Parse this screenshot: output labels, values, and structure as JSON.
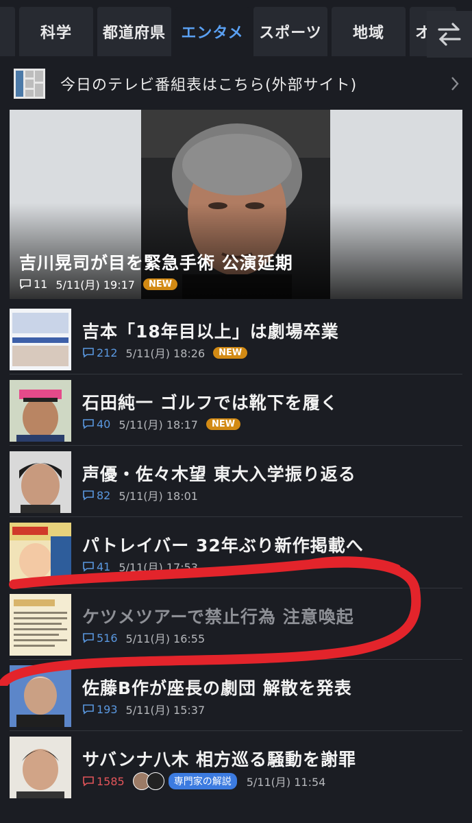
{
  "tabs": [
    {
      "label": "",
      "active": false
    },
    {
      "label": "科学",
      "active": false
    },
    {
      "label": "都道府県",
      "active": false
    },
    {
      "label": "エンタメ",
      "active": true
    },
    {
      "label": "スポーツ",
      "active": false
    },
    {
      "label": "地域",
      "active": false
    },
    {
      "label": "オ",
      "active": false
    }
  ],
  "tv_banner": {
    "text": "今日のテレビ番組表はこちら(外部サイト)"
  },
  "hero": {
    "title": "吉川晃司が目を緊急手術 公演延期",
    "comments": "11",
    "time": "5/11(月) 19:17",
    "badge": "NEW"
  },
  "articles": [
    {
      "title": "吉本「18年目以上」は劇場卒業",
      "comments": "212",
      "time": "5/11(月) 18:26",
      "badge": "NEW"
    },
    {
      "title": "石田純一 ゴルフでは靴下を履く",
      "comments": "40",
      "time": "5/11(月) 18:17",
      "badge": "NEW"
    },
    {
      "title": "声優・佐々木望 東大入学振り返る",
      "comments": "82",
      "time": "5/11(月) 18:01"
    },
    {
      "title": "パトレイバー 32年ぶり新作掲載へ",
      "comments": "41",
      "time": "5/11(月) 17:53"
    },
    {
      "title": "ケツメツアーで禁止行為 注意喚起",
      "comments": "516",
      "time": "5/11(月) 16:55"
    },
    {
      "title": "佐藤B作が座長の劇団 解散を発表",
      "comments": "193",
      "time": "5/11(月) 15:37"
    },
    {
      "title": "サバンナ八木 相方巡る騒動を謝罪",
      "comments": "1585",
      "time": "5/11(月) 11:54",
      "expert": "専門家の解説"
    }
  ],
  "colors": {
    "background": "#1b1d23",
    "accent": "#5aa0f2",
    "new_badge": "#d28a14",
    "highlight": "#e3242b"
  }
}
